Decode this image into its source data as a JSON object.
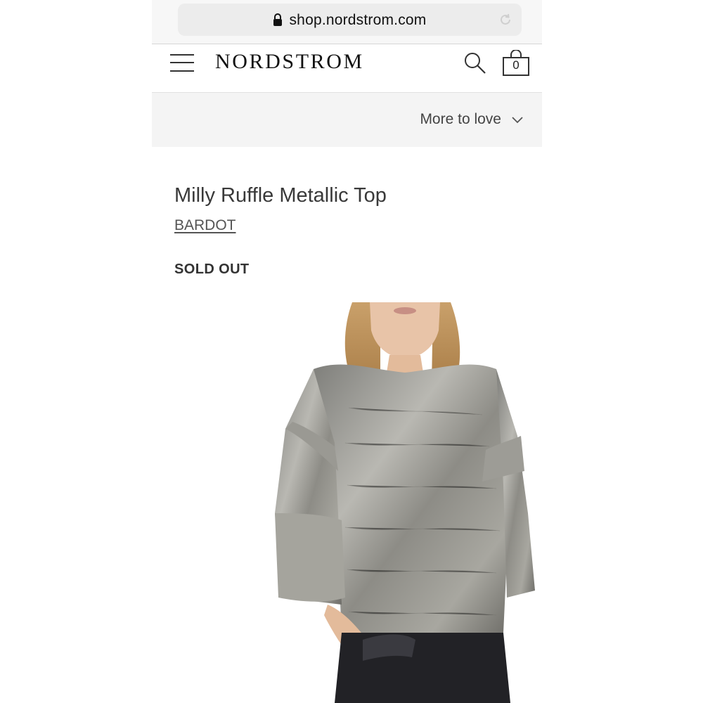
{
  "browser": {
    "url": "shop.nordstrom.com",
    "lock_icon": "lock-icon",
    "reload_icon": "reload-icon"
  },
  "header": {
    "brand": "NORDSTROM",
    "menu_icon": "hamburger-menu-icon",
    "search_icon": "search-icon",
    "bag_icon": "shopping-bag-icon",
    "bag_count": "0"
  },
  "more_to_love": {
    "label": "More to love",
    "icon": "chevron-down-icon"
  },
  "product": {
    "title": "Milly Ruffle Metallic Top",
    "brand": "BARDOT",
    "status": "SOLD OUT"
  },
  "colors": {
    "page_bg": "#ffffff",
    "bar_bg": "#f4f4f4",
    "text": "#393939"
  }
}
